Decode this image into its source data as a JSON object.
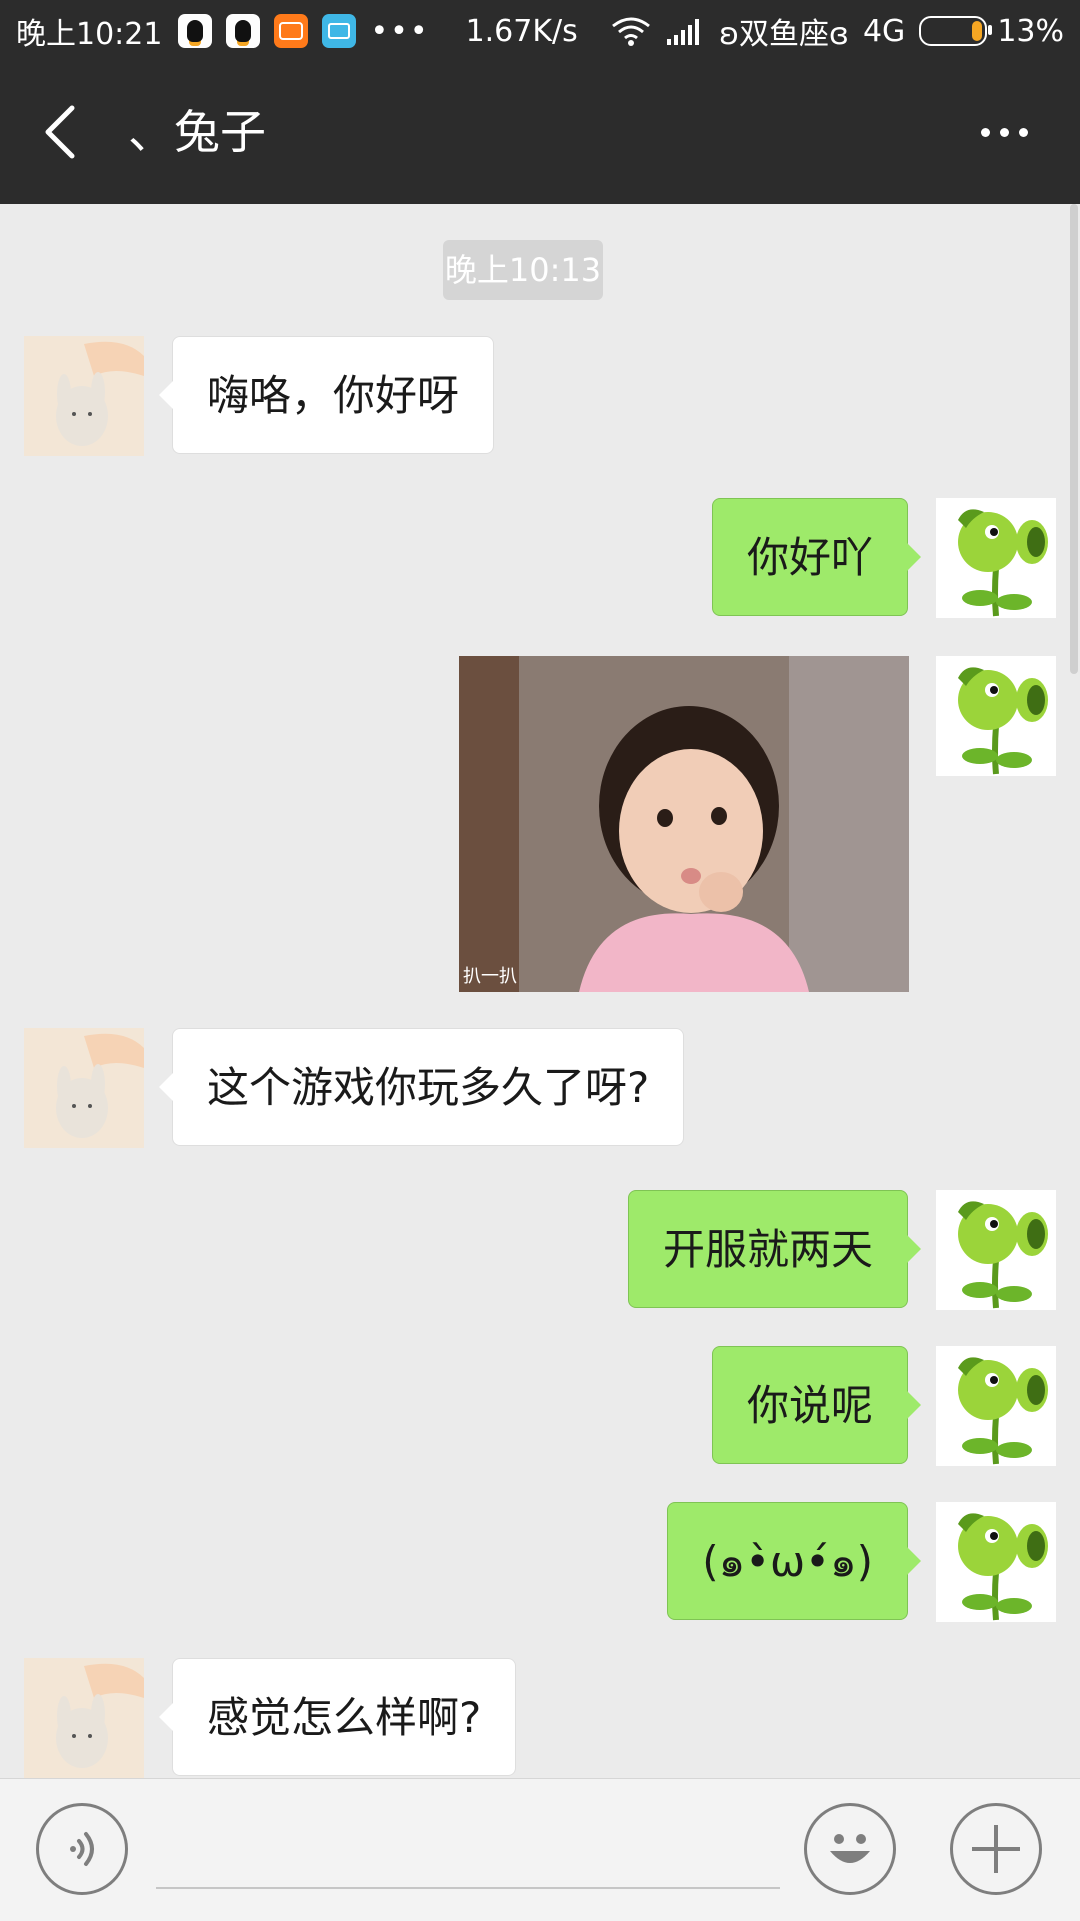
{
  "status_bar": {
    "time": "晚上10:21",
    "more": "•••",
    "speed": "1.67K/s",
    "carrier": "ʚ双鱼座ɞ",
    "network": "4G",
    "battery": "13%",
    "battery_level": 0.13
  },
  "nav": {
    "back_icon": "chevron-left-icon",
    "title": "、兔子",
    "more_icon": "more-dots-icon"
  },
  "chat": {
    "timestamp": "晚上10:13",
    "messages": [
      {
        "from": "friend",
        "type": "text",
        "text": "嗨咯，你好呀"
      },
      {
        "from": "me",
        "type": "text",
        "text": "你好吖"
      },
      {
        "from": "me",
        "type": "image",
        "caption": "扒一扒"
      },
      {
        "from": "friend",
        "type": "text",
        "text": "这个游戏你玩多久了呀?"
      },
      {
        "from": "me",
        "type": "text",
        "text": "开服就两天"
      },
      {
        "from": "me",
        "type": "text",
        "text": "你说呢"
      },
      {
        "from": "me",
        "type": "text",
        "text": "(๑•̀ω•́๑)"
      },
      {
        "from": "friend",
        "type": "text",
        "text": "感觉怎么样啊?"
      }
    ]
  },
  "input_bar": {
    "voice_icon": "voice-icon",
    "emoji_icon": "emoji-icon",
    "plus_icon": "plus-icon"
  },
  "colors": {
    "bar_bg": "#2c2c2c",
    "chat_bg": "#ebebeb",
    "out_bubble": "#9eea6a",
    "in_bubble": "#ffffff"
  }
}
